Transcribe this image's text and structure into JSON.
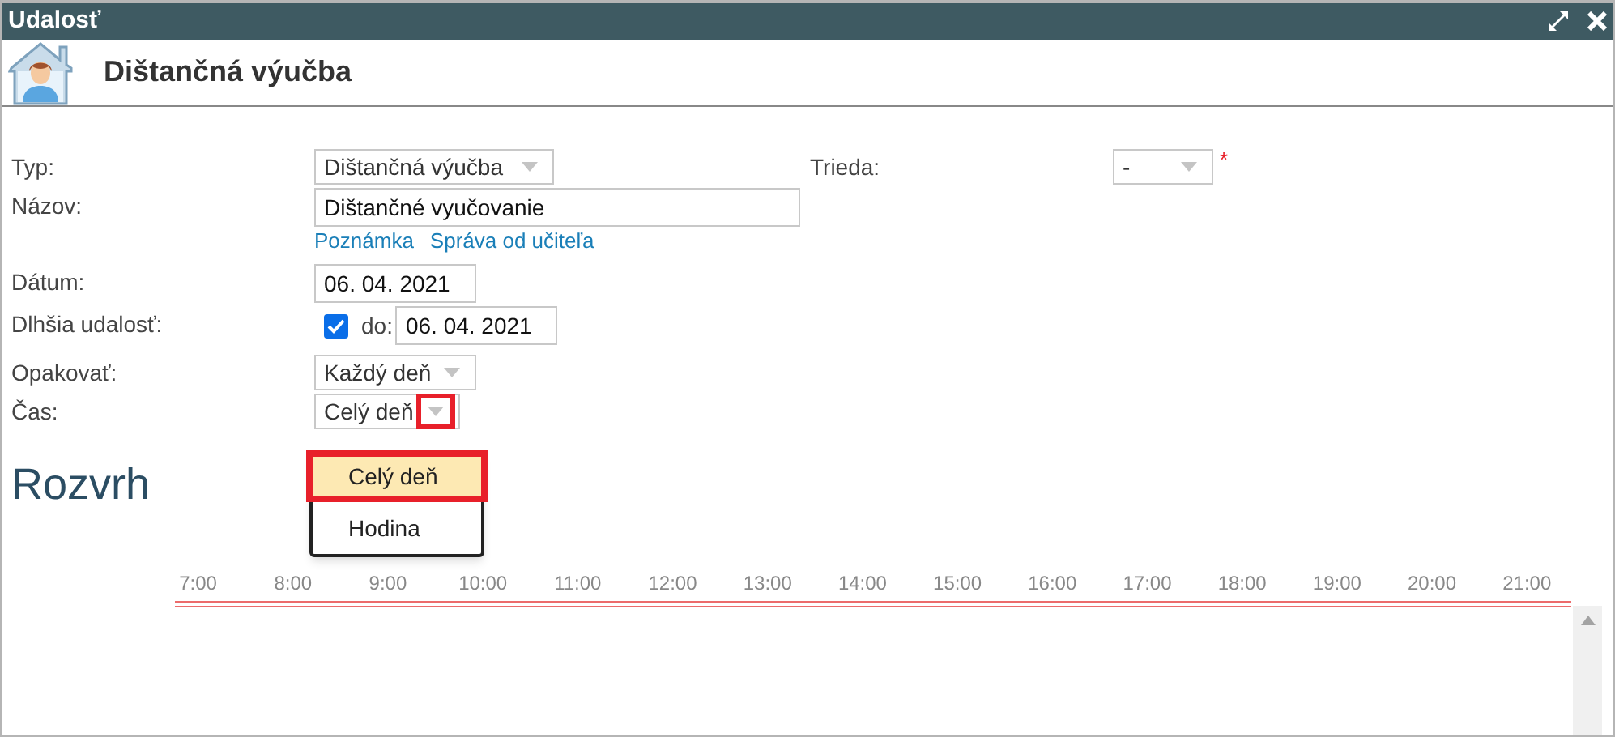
{
  "window": {
    "title": "Udalosť"
  },
  "header": {
    "title": "Dištančná výučba"
  },
  "fields": [
    {
      "kind": "select",
      "label": "Typ:",
      "value": "Dištančná výučba"
    },
    {
      "kind": "text",
      "label": "Názov:",
      "value": "Dištančné vyučovanie",
      "links": [
        "Poznámka",
        "Správa od učiteľa"
      ]
    },
    {
      "kind": "text",
      "label": "Dátum:",
      "value": "06. 04. 2021"
    },
    {
      "kind": "checkbox_date",
      "label": "Dlhšia udalosť:",
      "checked": true,
      "to_label": "do:",
      "value": "06. 04. 2021"
    },
    {
      "kind": "select",
      "label": "Opakovať:",
      "value": "Každý deň"
    },
    {
      "kind": "select",
      "label": "Čas:",
      "value": "Celý deň",
      "expanded": true,
      "options": [
        {
          "label": "Celý deň",
          "selected": true
        },
        {
          "label": "Hodina",
          "selected": false
        }
      ]
    }
  ],
  "class_field": {
    "label": "Trieda:",
    "value": "-",
    "required_mark": "*"
  },
  "schedule": {
    "title": "Rozvrh",
    "hours": [
      "7:00",
      "8:00",
      "9:00",
      "10:00",
      "11:00",
      "12:00",
      "13:00",
      "14:00",
      "15:00",
      "16:00",
      "17:00",
      "18:00",
      "19:00",
      "20:00",
      "21:00"
    ]
  }
}
